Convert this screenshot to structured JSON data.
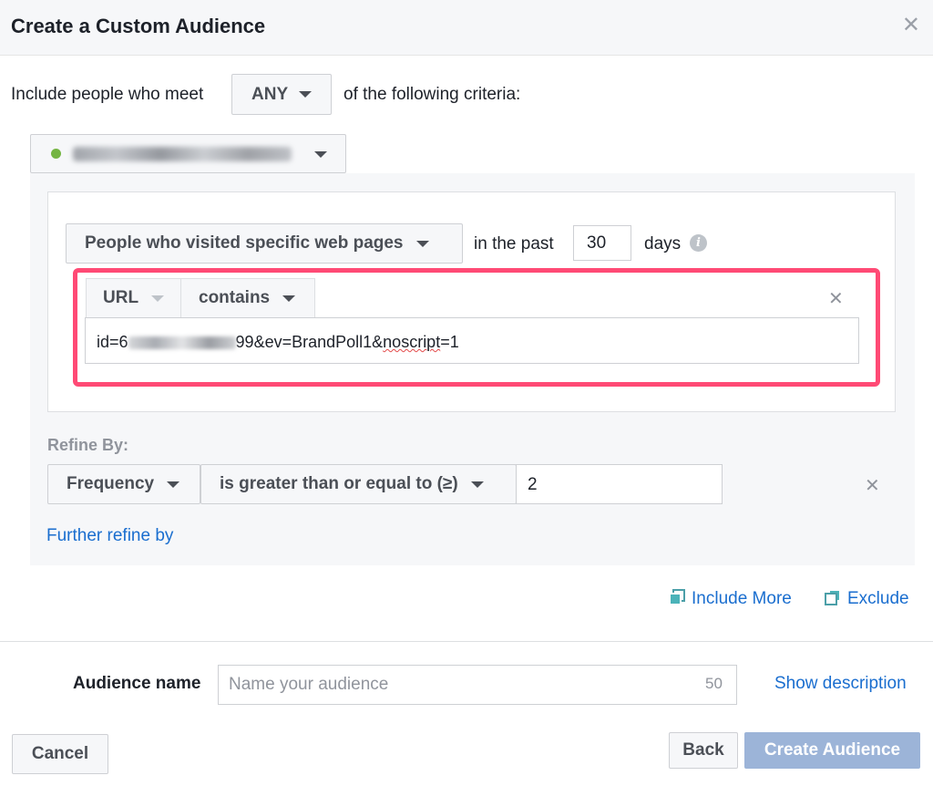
{
  "dialog": {
    "title": "Create a Custom Audience",
    "close_glyph": "✕"
  },
  "criteria": {
    "prefix": "Include people who meet",
    "match_value": "ANY",
    "suffix": "of the following criteria:"
  },
  "pixel": {
    "status_color": "#75b543",
    "name": "(redacted pixel name)"
  },
  "rule": {
    "traffic_type": "People who visited specific web pages",
    "in_past_label": "in the past",
    "days_value": "30",
    "days_label": "days",
    "info_glyph": "i",
    "url_label": "URL",
    "operator": "contains",
    "remove_glyph": "✕",
    "url_value_prefix": "id=6",
    "url_value_hidden": "(redacted)",
    "url_value_mid": "99&ev=BrandPoll1&",
    "url_value_squiggle": "noscript",
    "url_value_end": "=1"
  },
  "refine": {
    "label": "Refine By:",
    "field": "Frequency",
    "comparator": "is greater than or equal to (≥)",
    "value": "2",
    "remove_glyph": "✕",
    "further_link": "Further refine by"
  },
  "actions": {
    "include_more": "Include More",
    "exclude": "Exclude"
  },
  "audience": {
    "name_label": "Audience name",
    "name_placeholder": "Name your audience",
    "char_limit": "50",
    "show_description": "Show description"
  },
  "footer": {
    "cancel": "Cancel",
    "back": "Back",
    "create": "Create Audience"
  },
  "colors": {
    "highlight": "#ff4a75",
    "link": "#1a6ecf",
    "primary_disabled": "#9cb4d8"
  }
}
